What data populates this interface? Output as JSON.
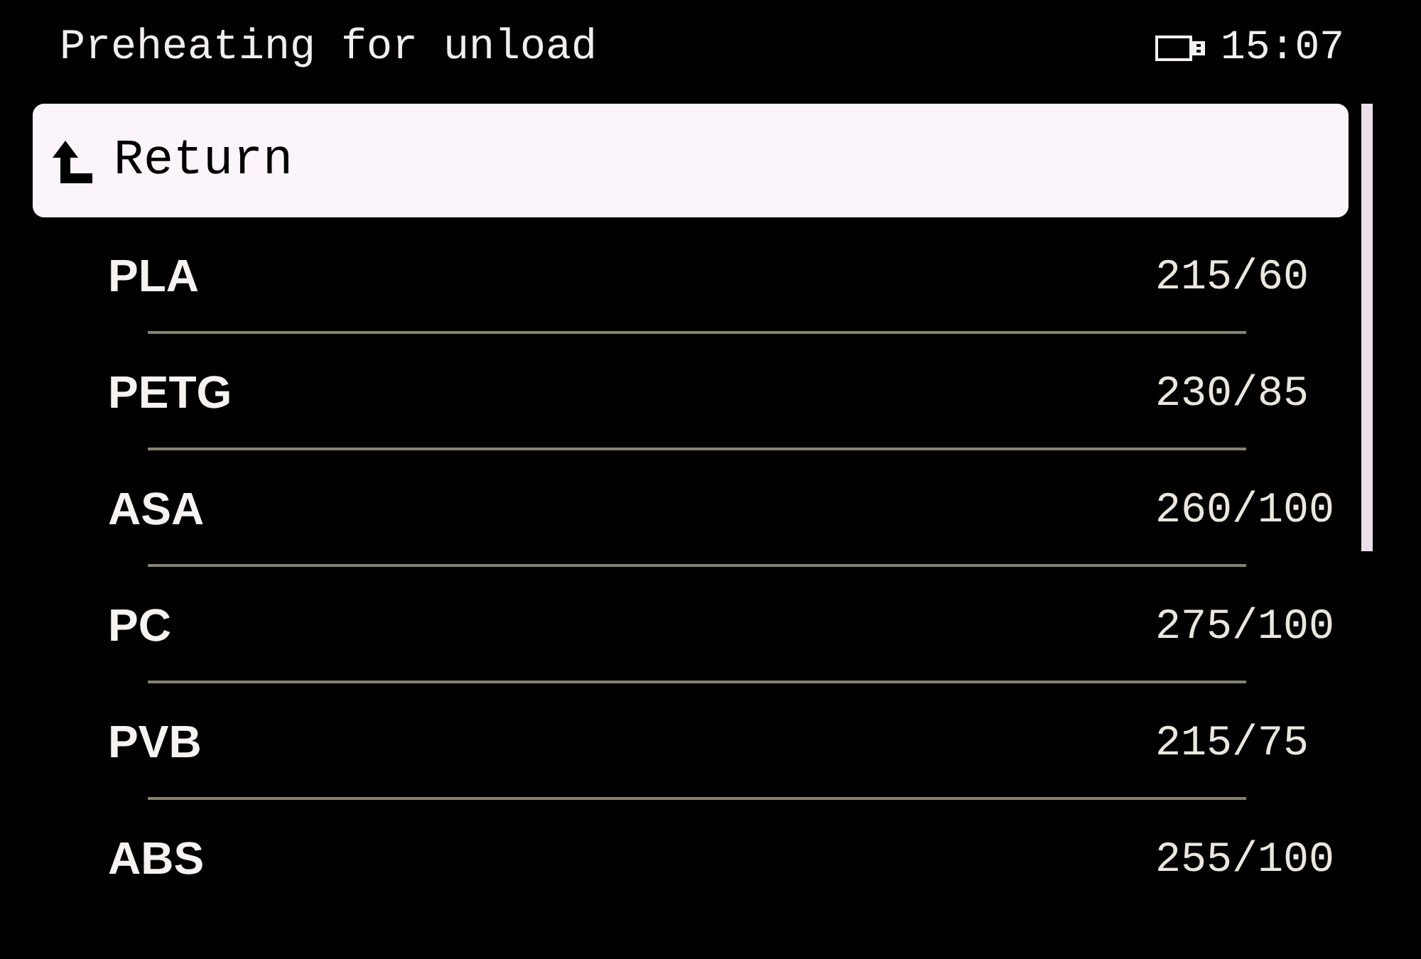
{
  "header": {
    "title": "Preheating for unload",
    "time": "15:07"
  },
  "menu": [
    {
      "kind": "return",
      "label": "Return",
      "selected": true
    },
    {
      "kind": "material",
      "label": "PLA",
      "value": "215/60",
      "selected": false
    },
    {
      "kind": "material",
      "label": "PETG",
      "value": "230/85",
      "selected": false
    },
    {
      "kind": "material",
      "label": "ASA",
      "value": "260/100",
      "selected": false
    },
    {
      "kind": "material",
      "label": "PC",
      "value": "275/100",
      "selected": false
    },
    {
      "kind": "material",
      "label": "PVB",
      "value": "215/75",
      "selected": false
    },
    {
      "kind": "material",
      "label": "ABS",
      "value": "255/100",
      "selected": false
    }
  ]
}
